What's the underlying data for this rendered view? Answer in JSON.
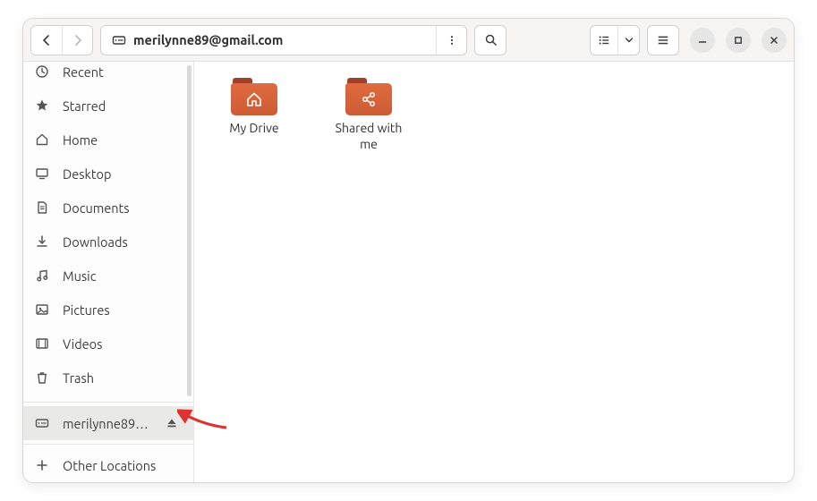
{
  "path": {
    "label": "merilynne89@gmail.com"
  },
  "sidebar": {
    "items": [
      {
        "id": "recent",
        "label": "Recent"
      },
      {
        "id": "starred",
        "label": "Starred"
      },
      {
        "id": "home",
        "label": "Home"
      },
      {
        "id": "desktop",
        "label": "Desktop"
      },
      {
        "id": "documents",
        "label": "Documents"
      },
      {
        "id": "downloads",
        "label": "Downloads"
      },
      {
        "id": "music",
        "label": "Music"
      },
      {
        "id": "pictures",
        "label": "Pictures"
      },
      {
        "id": "videos",
        "label": "Videos"
      },
      {
        "id": "trash",
        "label": "Trash"
      }
    ],
    "mounts": [
      {
        "id": "gdrive",
        "label": "merilynne89…",
        "active": true,
        "ejectable": true
      }
    ],
    "other": {
      "label": "Other Locations"
    }
  },
  "content": {
    "items": [
      {
        "id": "my-drive",
        "label": "My Drive",
        "glyph": "home"
      },
      {
        "id": "shared-with-me",
        "label": "Shared with\nme",
        "glyph": "share"
      }
    ]
  }
}
